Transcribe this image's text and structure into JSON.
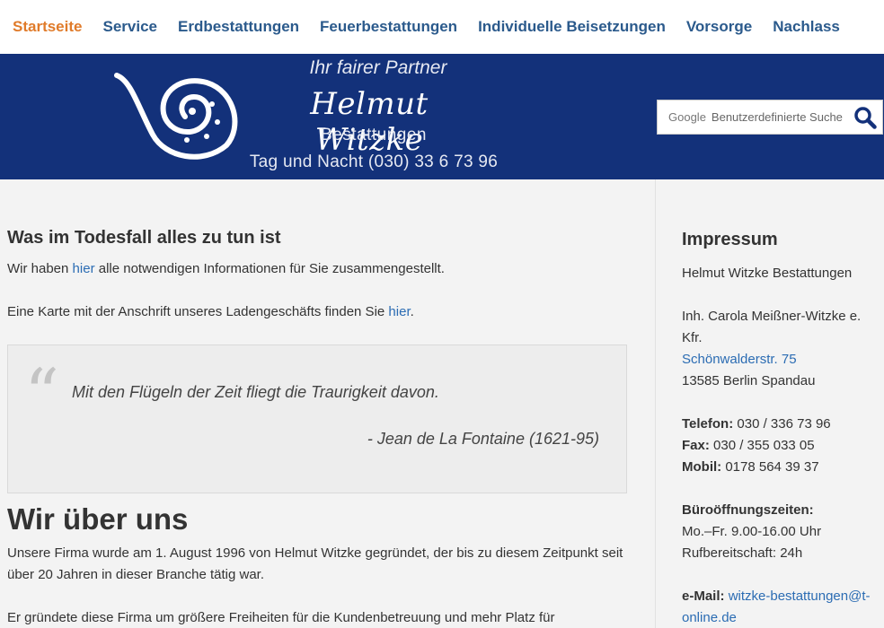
{
  "nav": {
    "items": [
      {
        "label": "Startseite",
        "active": true
      },
      {
        "label": "Service"
      },
      {
        "label": "Erdbestattungen"
      },
      {
        "label": "Feuerbestattungen"
      },
      {
        "label": "Individuelle Beisetzungen"
      },
      {
        "label": "Vorsorge"
      },
      {
        "label": "Nachlass"
      }
    ]
  },
  "header": {
    "tagline": "Ihr fairer Partner",
    "brand": "Helmut Witzke",
    "sub": "Bestattungen",
    "phone": "Tag und Nacht (030) 33 6 73 96",
    "background_color": "#13317a",
    "logo_icon": "spiral-logo-icon"
  },
  "search": {
    "provider_label": "Google",
    "placeholder": "Benutzerdefinierte Suche",
    "button_icon": "search-icon"
  },
  "main": {
    "section1_title": "Was im Todesfall alles zu tun ist",
    "p1_before": "Wir haben ",
    "p1_link": "hier",
    "p1_after": " alle notwendigen Informationen für Sie zusammengestellt.",
    "p2_before": "Eine Karte mit der Anschrift unseres Ladengeschäfts finden Sie ",
    "p2_link": "hier",
    "p2_after": ".",
    "quote_text": "Mit den Flügeln der Zeit fliegt die Traurigkeit davon.",
    "quote_author": "- Jean de La Fontaine (1621-95)",
    "section2_title": "Wir über uns",
    "about_line1": "Unsere Firma wurde am 1. August 1996 von Helmut Witzke gegründet, der bis zu diesem Zeitpunkt seit",
    "about_line2": "über 20 Jahren in dieser Branche tätig war.",
    "about_line3": "Er gründete diese Firma um größere Freiheiten für die Kundenbetreuung und mehr Platz für"
  },
  "sidebar": {
    "title": "Impressum",
    "company": "Helmut Witzke Bestattungen",
    "owner_line1": "Inh. Carola Meißner-Witzke e.",
    "owner_line2": "Kfr.",
    "street": "Schönwalderstr. 75",
    "city": "13585 Berlin Spandau",
    "phone_label": "Telefon:",
    "phone": " 030 / 336 73 96",
    "fax_label": "Fax:",
    "fax": " 030 / 355 033 05",
    "mobile_label": "Mobil:",
    "mobile": " 0178 564 39 37",
    "hours_label": "Büroöffnungszeiten:",
    "hours": "Mo.–Fr. 9.00-16.00 Uhr",
    "oncall": "Rufbereitschaft: 24h",
    "email_label": "e-Mail:",
    "email_line1": "witzke-bestattungen@t-",
    "email_line2": "online.de"
  }
}
